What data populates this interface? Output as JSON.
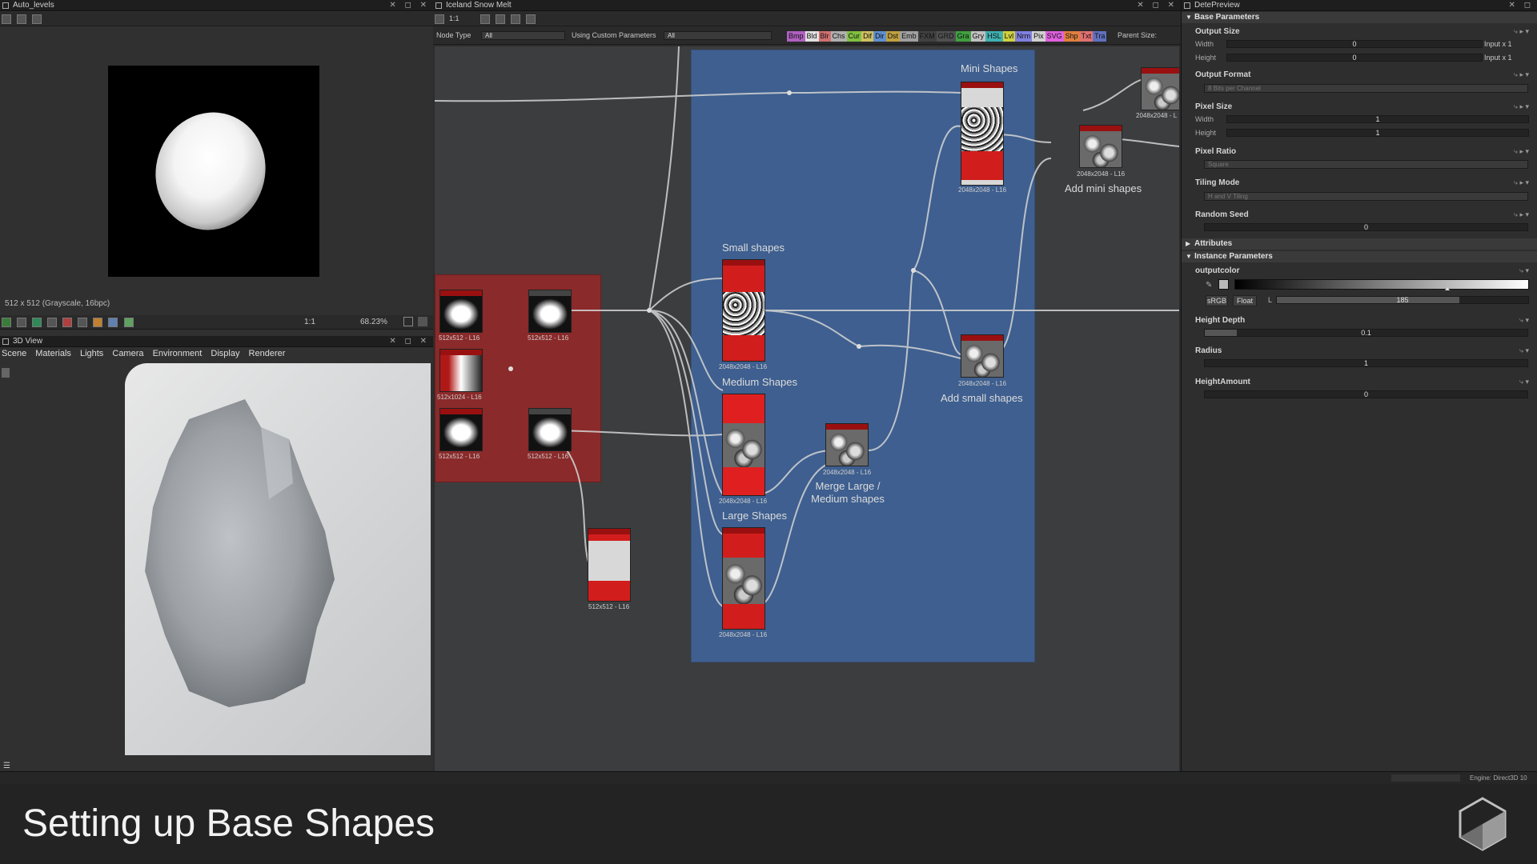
{
  "colors": {
    "accent_red": "#d21d1d",
    "frame_blue": "#3e5f8f",
    "frame_red": "#8a2a2a"
  },
  "viewer": {
    "title": "Auto_levels",
    "info": "512 x 512 (Grayscale, 16bpc)",
    "zoom_ratio": "1:1",
    "zoom": "68.23%"
  },
  "view3d": {
    "title": "3D View",
    "menu": [
      "Scene",
      "Materials",
      "Lights",
      "Camera",
      "Environment",
      "Display",
      "Renderer"
    ]
  },
  "graph": {
    "title": "Iceland Snow Melt",
    "zoom_ratio": "1:1",
    "filter": {
      "node_type_label": "Node Type",
      "node_type_value": "All",
      "custom_label": "Using Custom Parameters",
      "custom_value": "All",
      "parent_size_label": "Parent Size:"
    },
    "filter_buttons": [
      {
        "label": "Bmp",
        "color": "#b060c0"
      },
      {
        "label": "Bld",
        "color": "#e0e0e0"
      },
      {
        "label": "Blr",
        "color": "#d07070"
      },
      {
        "label": "Chs",
        "color": "#b0b0b0"
      },
      {
        "label": "Cur",
        "color": "#80c040"
      },
      {
        "label": "Dif",
        "color": "#d0c060"
      },
      {
        "label": "Dir",
        "color": "#6090d0"
      },
      {
        "label": "Dst",
        "color": "#c0a040"
      },
      {
        "label": "Emb",
        "color": "#a0a0a0"
      },
      {
        "label": "FXM",
        "color": "#404040"
      },
      {
        "label": "GRD",
        "color": "#505050"
      },
      {
        "label": "Gra",
        "color": "#40a040"
      },
      {
        "label": "Gry",
        "color": "#c0c0c0"
      },
      {
        "label": "HSL",
        "color": "#40b0b0"
      },
      {
        "label": "Lvl",
        "color": "#d0d040"
      },
      {
        "label": "Nrm",
        "color": "#8080e0"
      },
      {
        "label": "Pix",
        "color": "#d0d0d0"
      },
      {
        "label": "SVG",
        "color": "#e060e0"
      },
      {
        "label": "Shp",
        "color": "#e08040"
      },
      {
        "label": "Txt",
        "color": "#e07070"
      },
      {
        "label": "Tra",
        "color": "#6070c0"
      }
    ],
    "frames": {
      "mini_shapes": "Mini Shapes",
      "small_shapes": "Small shapes",
      "medium_shapes": "Medium Shapes",
      "large_shapes": "Large Shapes"
    },
    "node_labels": {
      "mini": "2048x2048 - L16",
      "small": "2048x2048 - L16",
      "medium": "2048x2048 - L16",
      "large": "2048x2048 - L16",
      "merge": "2048x2048 - L16",
      "add_small": "2048x2048 - L16",
      "add_mini": "2048x2048 - L16",
      "blob1": "512x512 - L16",
      "blob2": "512x512 - L16",
      "grad": "512x1024 - L16",
      "blob3": "512x512 - L16",
      "blob4": "512x512 - L16",
      "preview": "512x512 - L16",
      "topright": "2048x2048 - L"
    },
    "captions": {
      "merge": "Merge Large / Medium shapes",
      "add_small": "Add small shapes",
      "add_mini": "Add mini shapes"
    }
  },
  "properties": {
    "title": "DetePreview",
    "base_section": "Base Parameters",
    "output_size": {
      "label": "Output Size",
      "width_label": "Width",
      "width_value": "0",
      "width_suffix": "Input x 1",
      "height_label": "Height",
      "height_value": "0",
      "height_suffix": "Input x 1"
    },
    "output_format": {
      "label": "Output Format",
      "value": "8 Bits per Channel"
    },
    "pixel_size": {
      "label": "Pixel Size",
      "width_label": "Width",
      "width_value": "1",
      "height_label": "Height",
      "height_value": "1"
    },
    "pixel_ratio": {
      "label": "Pixel Ratio",
      "value": "Square"
    },
    "tiling_mode": {
      "label": "Tiling Mode",
      "value": "H and V Tiling"
    },
    "random_seed": {
      "label": "Random Seed",
      "value": "0"
    },
    "attributes_section": "Attributes",
    "instance_section": "Instance Parameters",
    "outputcolor": {
      "label": "outputcolor",
      "mode_srgb": "sRGB",
      "mode_float": "Float",
      "channel": "L",
      "value": "185",
      "level": 0.725
    },
    "height_depth": {
      "label": "Height Depth",
      "value": "0.1",
      "level": 0.1
    },
    "radius": {
      "label": "Radius",
      "value": "1"
    },
    "height_amount": {
      "label": "HeightAmount",
      "value": "0"
    }
  },
  "status": {
    "engine": "Engine: Direct3D 10"
  },
  "caption": "Setting up Base Shapes"
}
